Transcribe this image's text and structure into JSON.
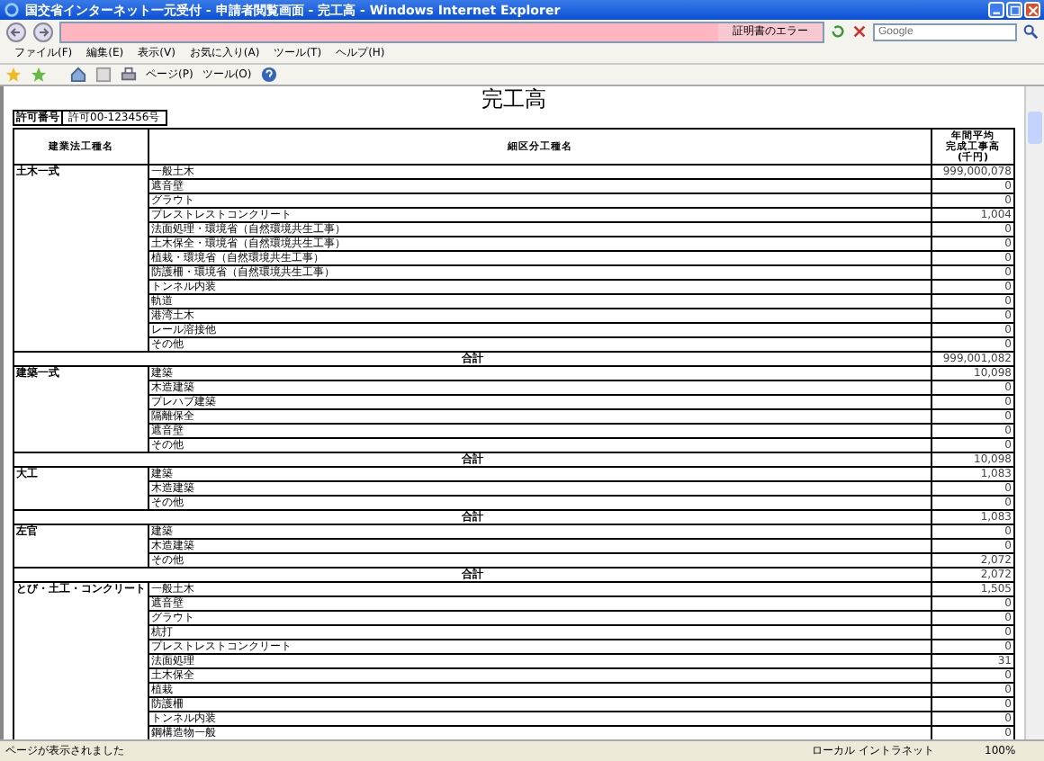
{
  "window": {
    "title": "国交省インターネット一元受付 - 申請者閲覧画面 - 完工高 - Windows Internet Explorer"
  },
  "address_bar": {
    "cert_error": "証明書のエラー",
    "search_placeholder": "Google"
  },
  "menu": [
    "ファイル(F)",
    "編集(E)",
    "表示(V)",
    "お気に入り(A)",
    "ツール(T)",
    "ヘルプ(H)"
  ],
  "toolbar": {
    "page_label": "ページ(P)",
    "tools_label": "ツール(O)"
  },
  "page": {
    "title": "完工高",
    "permit_label": "許可番号",
    "permit_value": "許可00-123456号"
  },
  "table": {
    "columns": [
      {
        "lines": [
          "建業法工種名"
        ]
      },
      {
        "lines": [
          "細区分工種名"
        ]
      },
      {
        "lines": [
          "年間平均",
          "完成工事高",
          "(千円)"
        ]
      }
    ],
    "groups": [
      {
        "name": "土木一式",
        "rows": [
          {
            "item": "一般土木",
            "amount": "999,000,078"
          },
          {
            "item": "遮音壁",
            "amount": "0"
          },
          {
            "item": "グラウト",
            "amount": "0"
          },
          {
            "item": "プレストレストコンクリート",
            "amount": "1,004"
          },
          {
            "item": "法面処理・環境省（自然環境共生工事）",
            "amount": "0"
          },
          {
            "item": "土木保全・環境省（自然環境共生工事）",
            "amount": "0"
          },
          {
            "item": "植栽・環境省（自然環境共生工事）",
            "amount": "0"
          },
          {
            "item": "防護柵・環境省（自然環境共生工事）",
            "amount": "0"
          },
          {
            "item": "トンネル内装",
            "amount": "0"
          },
          {
            "item": "軌道",
            "amount": "0"
          },
          {
            "item": "港湾土木",
            "amount": "0"
          },
          {
            "item": "レール溶接他",
            "amount": "0"
          },
          {
            "item": "その他",
            "amount": "0"
          }
        ],
        "total_label": "合計",
        "total": "999,001,082"
      },
      {
        "name": "建築一式",
        "rows": [
          {
            "item": "建築",
            "amount": "10,098"
          },
          {
            "item": "木造建築",
            "amount": "0"
          },
          {
            "item": "プレハブ建築",
            "amount": "0"
          },
          {
            "item": "隔離保全",
            "amount": "0"
          },
          {
            "item": "遮音壁",
            "amount": "0"
          },
          {
            "item": "その他",
            "amount": "0"
          }
        ],
        "total_label": "合計",
        "total": "10,098"
      },
      {
        "name": "大工",
        "rows": [
          {
            "item": "建築",
            "amount": "1,083"
          },
          {
            "item": "木造建築",
            "amount": "0"
          },
          {
            "item": "その他",
            "amount": "0"
          }
        ],
        "total_label": "合計",
        "total": "1,083"
      },
      {
        "name": "左官",
        "rows": [
          {
            "item": "建築",
            "amount": "0"
          },
          {
            "item": "木造建築",
            "amount": "0"
          },
          {
            "item": "その他",
            "amount": "2,072"
          }
        ],
        "total_label": "合計",
        "total": "2,072"
      },
      {
        "name": "とび・土工・コンクリート",
        "rows": [
          {
            "item": "一般土木",
            "amount": "1,505"
          },
          {
            "item": "遮音壁",
            "amount": "0"
          },
          {
            "item": "グラウト",
            "amount": "0"
          },
          {
            "item": "杭打",
            "amount": "0"
          },
          {
            "item": "プレストレストコンクリート",
            "amount": "0"
          },
          {
            "item": "法面処理",
            "amount": "31"
          },
          {
            "item": "土木保全",
            "amount": "0"
          },
          {
            "item": "植栽",
            "amount": "0"
          },
          {
            "item": "防護柵",
            "amount": "0"
          },
          {
            "item": "トンネル内装",
            "amount": "0"
          },
          {
            "item": "鋼構造物一般",
            "amount": "0"
          }
        ]
      }
    ]
  },
  "status_bar": {
    "message": "ページが表示されました",
    "zone": "ローカル イントラネット",
    "zoom": "100%"
  }
}
